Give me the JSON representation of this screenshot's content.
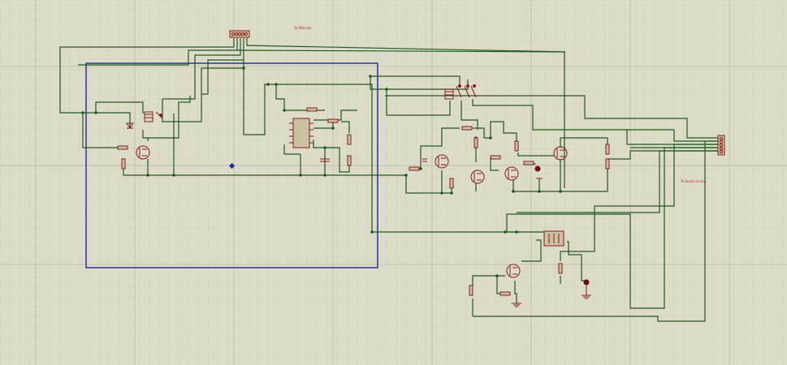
{
  "schematic": {
    "top_connector_label": "To RB/Leds",
    "right_connector_label": "To buses on/out",
    "colors": {
      "background": "#dcdcc8",
      "grid_minor": "#c8c8b4",
      "grid_major": "#b4b4a0",
      "wire": "#1e5a1e",
      "component": "#8b1a1a",
      "selection_box": "#1a2a9a"
    }
  }
}
